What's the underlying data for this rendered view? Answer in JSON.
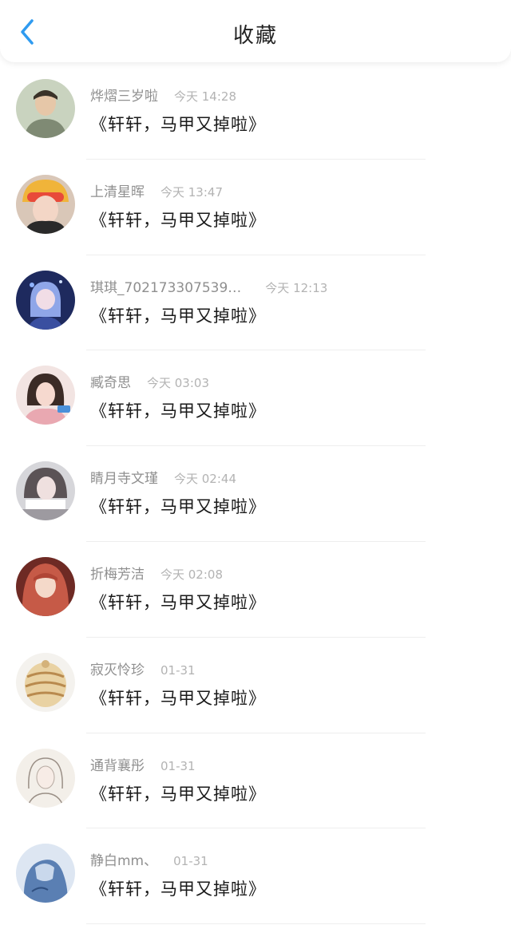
{
  "header": {
    "title": "收藏",
    "back_icon": "chevron-left-icon",
    "accent_color": "#2f9bf0"
  },
  "items": [
    {
      "name": "烨熠三岁啦",
      "time": "今天 14:28",
      "message": "《轩轩，马甲又掉啦》",
      "avatar_color": "#a7b59a"
    },
    {
      "name": "上清星晖",
      "time": "今天 13:47",
      "message": "《轩轩，马甲又掉啦》",
      "avatar_color": "#f0b43a"
    },
    {
      "name": "琪琪_702173307539…",
      "time": "今天 12:13",
      "message": "《轩轩，马甲又掉啦》",
      "avatar_color": "#2b3a7a"
    },
    {
      "name": "臧奇思",
      "time": "今天 03:03",
      "message": "《轩轩，马甲又掉啦》",
      "avatar_color": "#e8b7b3"
    },
    {
      "name": "睛月寺文瑾",
      "time": "今天 02:44",
      "message": "《轩轩，马甲又掉啦》",
      "avatar_color": "#bfbfc5"
    },
    {
      "name": "折梅芳洁",
      "time": "今天 02:08",
      "message": "《轩轩，马甲又掉啦》",
      "avatar_color": "#a8493d"
    },
    {
      "name": "寂灭怜珍",
      "time": "01-31",
      "message": "《轩轩，马甲又掉啦》",
      "avatar_color": "#e8d3a8"
    },
    {
      "name": "通背襄彤",
      "time": "01-31",
      "message": "《轩轩，马甲又掉啦》",
      "avatar_color": "#ece8e2"
    },
    {
      "name": "静白mm、",
      "time": "01-31",
      "message": "《轩轩，马甲又掉啦》",
      "avatar_color": "#5a7fb3"
    }
  ]
}
